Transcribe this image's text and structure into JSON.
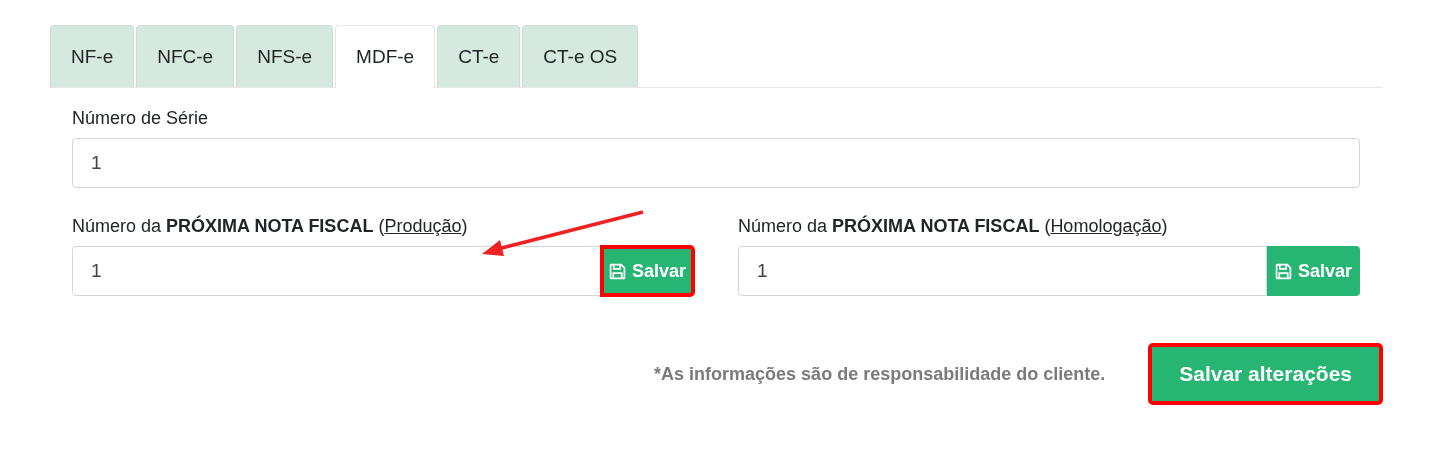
{
  "tabs": [
    {
      "label": "NF-e",
      "selected": false
    },
    {
      "label": "NFC-e",
      "selected": false
    },
    {
      "label": "NFS-e",
      "selected": false
    },
    {
      "label": "MDF-e",
      "selected": true
    },
    {
      "label": "CT-e",
      "selected": false
    },
    {
      "label": "CT-e OS",
      "selected": false
    }
  ],
  "serie": {
    "label": "Número de Série",
    "value": "1"
  },
  "next_numbers": [
    {
      "label": "Número da **PRÓXIMA NOTA FISCAL** (",
      "link": "Produção",
      "label_end": ")",
      "value": "1",
      "button": "Salvar",
      "highlighted": true,
      "arrow": true
    },
    {
      "label": "Número da **PRÓXIMA NOTA FISCAL** (",
      "link": "Homologação",
      "label_end": ")",
      "value": "1",
      "button": "Salvar",
      "highlighted": false,
      "arrow": false
    }
  ],
  "footer": {
    "note": "*As informações são de responsabilidade do cliente.",
    "button": "Salvar alterações",
    "highlighted": true
  }
}
